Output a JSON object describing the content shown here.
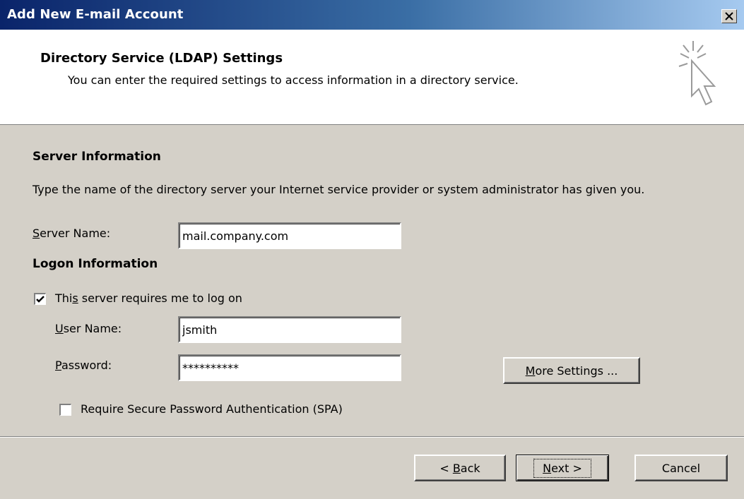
{
  "window": {
    "title": "Add New E-mail Account",
    "close_label": "×"
  },
  "header": {
    "title": "Directory Service (LDAP) Settings",
    "subtitle": "You can enter the required settings to access information in a directory service.",
    "icon": "wizard-cursor-icon"
  },
  "server_info": {
    "title": "Server Information",
    "description": "Type the name of the directory server your Internet service provider or system administrator has given you.",
    "server_name_label_first": "S",
    "server_name_label_rest": "erver Name:",
    "server_name_value": "mail.company.com"
  },
  "logon_info": {
    "title": "Logon Information",
    "requires_logon_checked": true,
    "requires_logon_label_a": "Thi",
    "requires_logon_label_u": "s",
    "requires_logon_label_b": " server requires me to log on",
    "user_name_label_first": "U",
    "user_name_label_rest": "ser Name:",
    "user_name_value": "jsmith",
    "password_label_first": "P",
    "password_label_rest": "assword:",
    "password_value": "**********",
    "spa_checked": false,
    "spa_label": "Require Secure Password Authentication (SPA)"
  },
  "buttons": {
    "more_settings_first": "M",
    "more_settings_rest": "ore Settings ...",
    "back_prefix": "< ",
    "back_first": "B",
    "back_rest": "ack",
    "next_first": "N",
    "next_rest": "ext >",
    "cancel": "Cancel"
  }
}
